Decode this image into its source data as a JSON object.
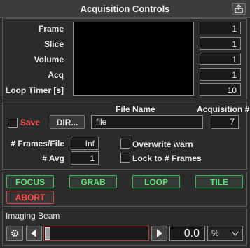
{
  "window": {
    "title": "Acquisition Controls",
    "export_icon": "export-icon"
  },
  "counters": [
    {
      "label": "Frame",
      "value": "1"
    },
    {
      "label": "Slice",
      "value": "1"
    },
    {
      "label": "Volume",
      "value": "1"
    },
    {
      "label": "Acq",
      "value": "1"
    },
    {
      "label": "Loop Timer [s]",
      "value": "10"
    }
  ],
  "file": {
    "save_label": "Save",
    "dir_label": "DIR...",
    "file_name_header": "File Name",
    "file_name_value": "file",
    "acq_header": "Acquisition #",
    "acq_value": "7",
    "frames_per_file_label": "# Frames/File",
    "frames_per_file_value": "Inf",
    "avg_label": "# Avg",
    "avg_value": "1",
    "overwrite_label": "Overwrite warn",
    "lock_label": "Lock to # Frames"
  },
  "actions": {
    "focus": "FOCUS",
    "grab": "GRAB",
    "loop": "LOOP",
    "tile": "TILE",
    "abort": "ABORT"
  },
  "beam": {
    "title": "Imaging Beam",
    "value": "0.0",
    "level": 0,
    "unit": "%",
    "icons": {
      "settings": "gear-icon",
      "left": "arrow-left-icon",
      "right": "arrow-right-icon",
      "dropdown": "chevron-down-icon"
    }
  },
  "colors": {
    "green": "#5fe07a",
    "red": "#ff4e4e"
  }
}
